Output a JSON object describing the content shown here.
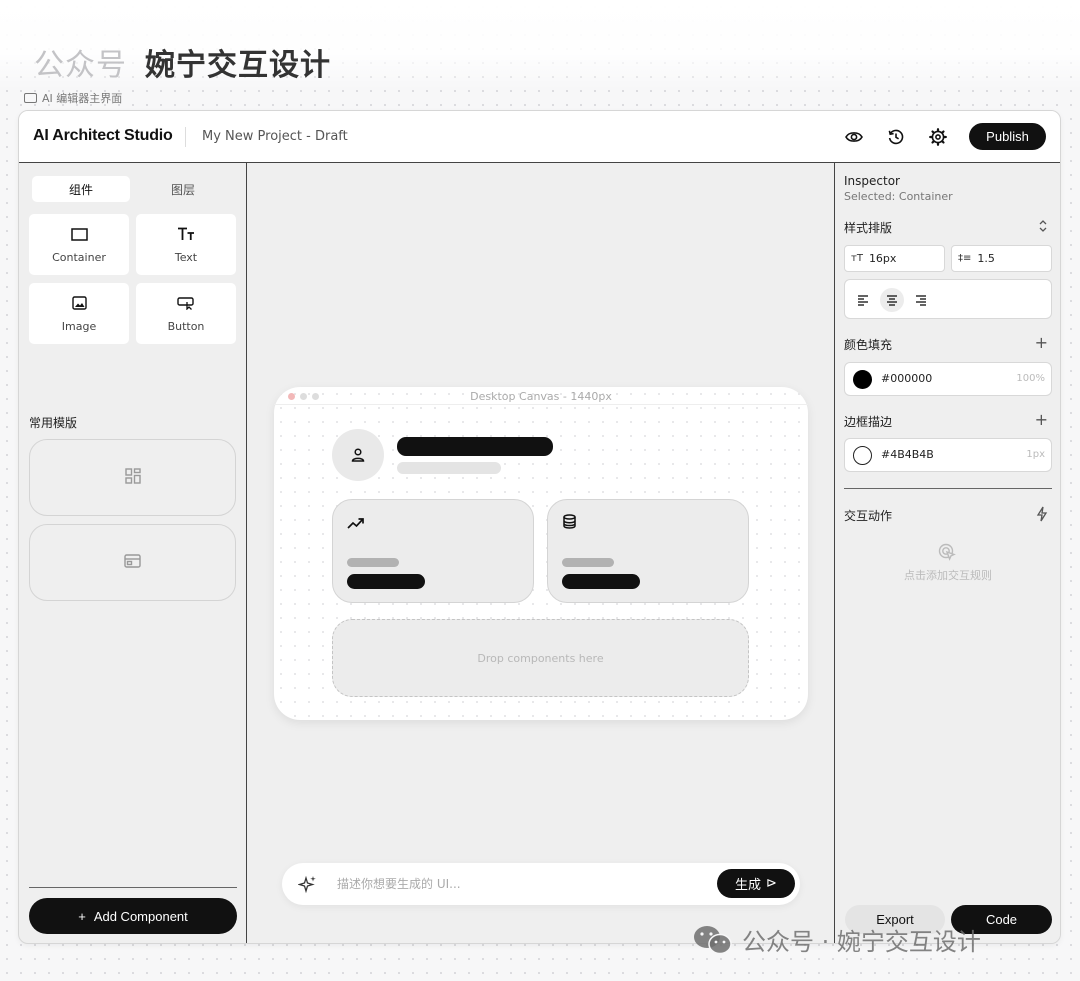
{
  "header": {
    "brand_gz": "公众号",
    "brand_name": "婉宁交互设计",
    "caption": "AI 编辑器主界面"
  },
  "topbar": {
    "app_title": "AI Architect Studio",
    "project_name": "My New Project - Draft",
    "publish_label": "Publish",
    "icons": [
      "eye-icon",
      "history-icon",
      "gear-icon"
    ]
  },
  "left_panel": {
    "tabs": [
      {
        "label": "组件",
        "active": true
      },
      {
        "label": "图层",
        "active": false
      }
    ],
    "components": [
      {
        "label": "Container",
        "icon": "container-icon"
      },
      {
        "label": "Text",
        "icon": "text-icon"
      },
      {
        "label": "Image",
        "icon": "image-icon"
      },
      {
        "label": "Button",
        "icon": "button-icon"
      }
    ],
    "templates_label": "常用模版",
    "templates": [
      "dashboard-template-icon",
      "window-template-icon"
    ],
    "add_label": "Add Component",
    "add_icon": "+"
  },
  "canvas": {
    "device_title": "Desktop Canvas - 1440px",
    "dropzone_label": "Drop components here",
    "stat_icons": [
      "trending-up-icon",
      "database-icon"
    ]
  },
  "prompt": {
    "placeholder": "描述你想要生成的 UI...",
    "generate_label": "生成",
    "generate_icon": "⊳"
  },
  "inspector": {
    "title": "Inspector",
    "selected": "Selected: Container",
    "typography_label": "样式排版",
    "font_size": "16px",
    "line_height": "1.5",
    "font_size_prefix": "тT",
    "line_height_prefix": "‡≡",
    "fill_label": "颜色填充",
    "fill_hex": "#000000",
    "fill_opacity": "100%",
    "fill_color": "#000000",
    "border_label": "边框描边",
    "border_hex": "#4B4B4B",
    "border_width": "1px",
    "interaction_label": "交互动作",
    "interaction_hint": "点击添加交互规则",
    "plus": "+",
    "export_label": "Export",
    "code_label": "Code"
  },
  "watermark": "公众号 · 婉宁交互设计"
}
